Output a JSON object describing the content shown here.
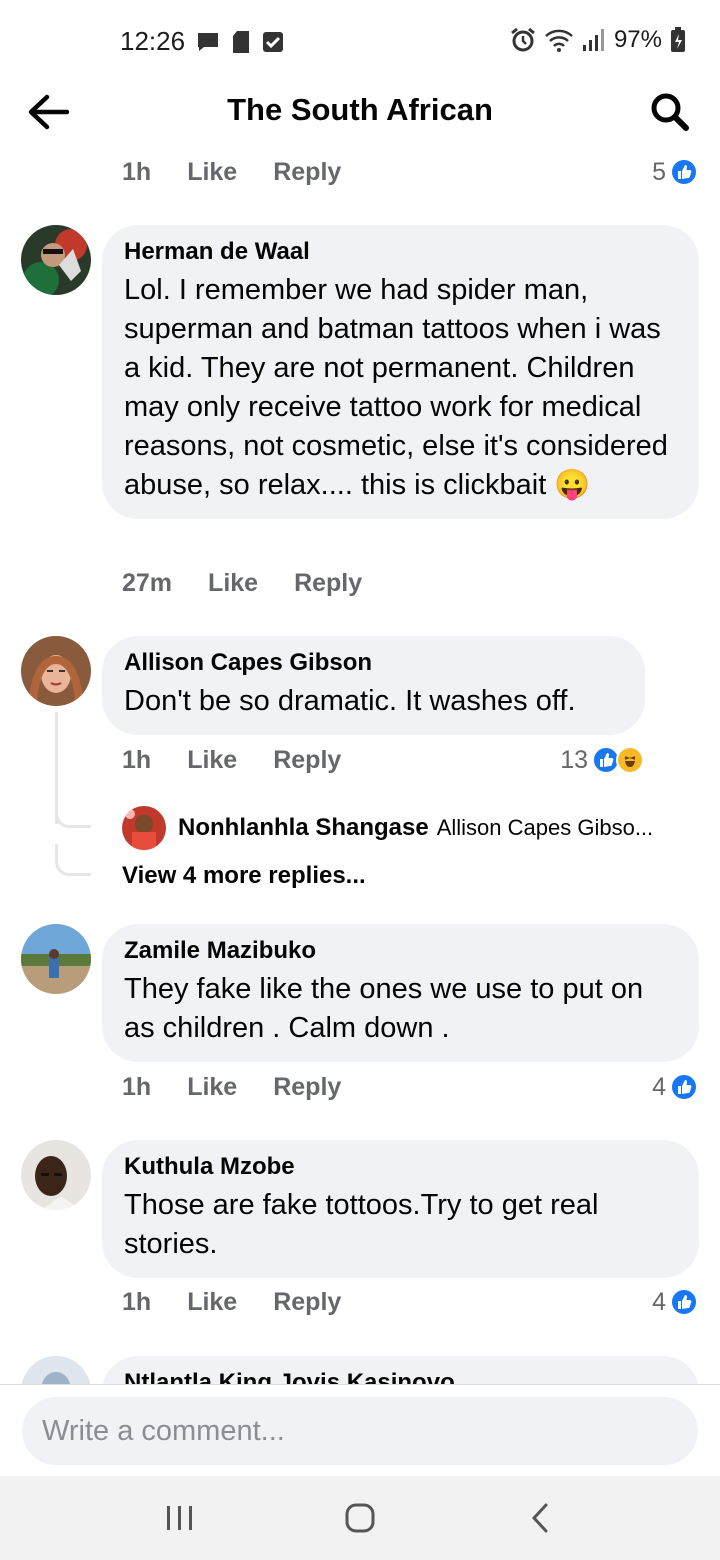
{
  "status_bar": {
    "time": "12:26",
    "battery": "97%"
  },
  "header": {
    "title": "The South African"
  },
  "colors": {
    "accent_blue": "#1877f2",
    "bubble_bg": "#f0f2f5",
    "meta_gray": "#65676b"
  },
  "top_meta": {
    "time": "1h",
    "like": "Like",
    "reply": "Reply",
    "reaction_count": "5"
  },
  "comments": [
    {
      "author": "Herman de Waal",
      "text": "Lol. I remember we had spider man, superman and batman tattoos when i was a kid. They are not permanent. Children may only receive tattoo work for medical reasons, not cosmetic, else it's considered abuse, so relax.... this is clickbait 😛",
      "time": "27m",
      "like": "Like",
      "reply": "Reply"
    },
    {
      "author": "Allison Capes Gibson",
      "text": "Don't be so dramatic.  It washes off.",
      "time": "1h",
      "like": "Like",
      "reply": "Reply",
      "reaction_count": "13",
      "reply_preview": {
        "author": "Nonhlanhla Shangase",
        "text": "Allison Capes Gibso..."
      },
      "view_more": "View 4 more replies..."
    },
    {
      "author": "Zamile Mazibuko",
      "text": "They fake like the ones we use to put on as children . Calm down .",
      "time": "1h",
      "like": "Like",
      "reply": "Reply",
      "reaction_count": "4"
    },
    {
      "author": "Kuthula Mzobe",
      "text": "Those are fake tottoos.Try to get real stories.",
      "time": "1h",
      "like": "Like",
      "reply": "Reply",
      "reaction_count": "4"
    },
    {
      "author": "Ntlantla King Jovis Kasinovo"
    }
  ],
  "composer": {
    "placeholder": "Write a comment..."
  }
}
